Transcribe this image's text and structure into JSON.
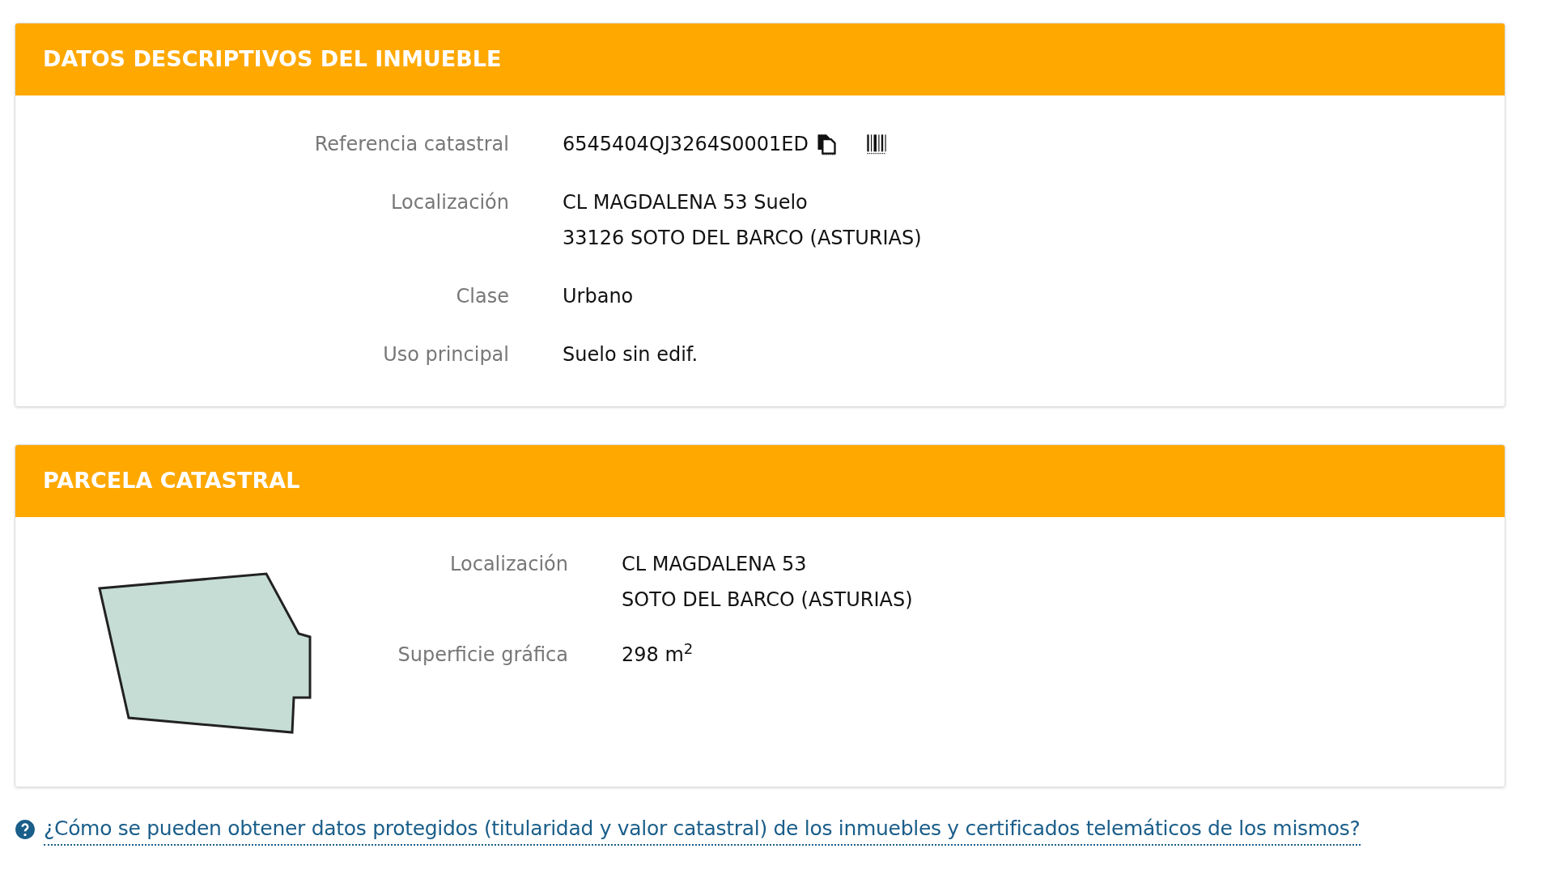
{
  "panels": [
    {
      "title": "DATOS DESCRIPTIVOS DEL INMUEBLE",
      "kind": "details",
      "rows": [
        {
          "label": "Referencia catastral",
          "lines": [
            "6545404QJ3264S0001ED"
          ],
          "kind": "reference"
        },
        {
          "label": "Localización",
          "lines": [
            "CL MAGDALENA 53 Suelo",
            "33126 SOTO DEL BARCO (ASTURIAS)"
          ],
          "kind": "text"
        },
        {
          "label": "Clase",
          "lines": [
            "Urbano"
          ],
          "kind": "text"
        },
        {
          "label": "Uso principal",
          "lines": [
            "Suelo sin edif."
          ],
          "kind": "text"
        }
      ]
    },
    {
      "title": "PARCELA CATASTRAL",
      "kind": "parcel",
      "rows": [
        {
          "label": "Localización",
          "lines": [
            "CL MAGDALENA 53",
            "SOTO DEL BARCO (ASTURIAS)"
          ],
          "kind": "text"
        },
        {
          "label": "Superficie gráfica",
          "lines": [
            "298 m$^{2}$"
          ],
          "kind": "text"
        }
      ]
    }
  ],
  "help_link": "¿Cómo se pueden obtener datos protegidos (titularidad y valor catastral) de los inmuebles y certificados telemáticos de los mismos?"
}
